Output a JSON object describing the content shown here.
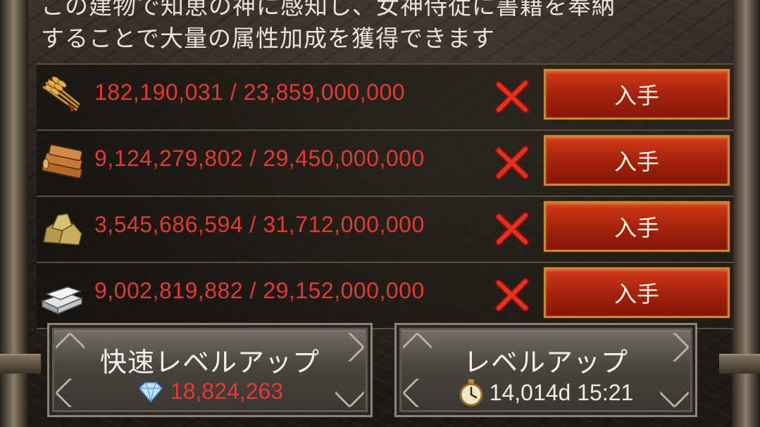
{
  "description": "この建物で知恵の神に感知し、女神侍従に書籍を奉納\nすることで大量の属性加成を獲得できます",
  "resources": [
    {
      "icon": "wheat-icon",
      "amount": "182,190,031 / 23,859,000,000",
      "button_label": "入手"
    },
    {
      "icon": "wood-icon",
      "amount": "9,124,279,802 / 29,450,000,000",
      "button_label": "入手"
    },
    {
      "icon": "stone-icon",
      "amount": "3,545,686,594 / 31,712,000,000",
      "button_label": "入手"
    },
    {
      "icon": "iron-icon",
      "amount": "9,002,819,882 / 29,152,000,000",
      "button_label": "入手"
    }
  ],
  "quick_upgrade": {
    "label": "快速レベルアップ",
    "gem_icon": "diamond-icon",
    "cost": "18,824,263"
  },
  "upgrade": {
    "label": "レベルアップ",
    "timer_icon": "stopwatch-icon",
    "time": "14,014d 15:21"
  },
  "colors": {
    "insufficient": "#e13a33",
    "button_red": "#b82a10",
    "button_border": "#c7892e"
  }
}
